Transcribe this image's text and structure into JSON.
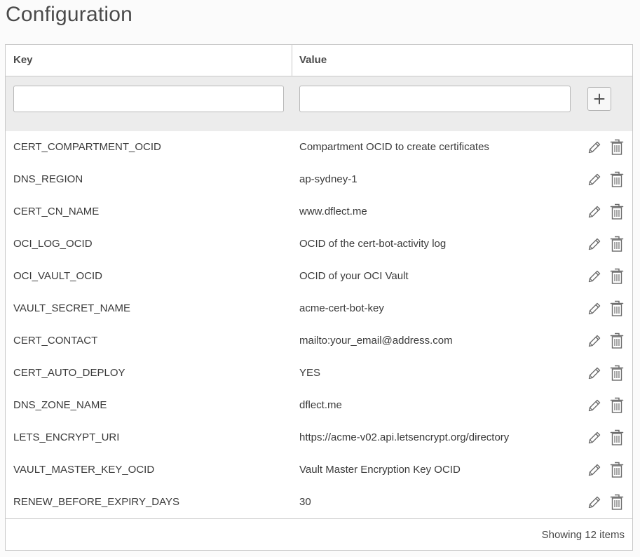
{
  "page": {
    "title": "Configuration"
  },
  "table": {
    "columns": {
      "key": "Key",
      "value": "Value"
    },
    "new_entry": {
      "key_value": "",
      "value_value": "",
      "add_icon": "plus-icon"
    },
    "rows": [
      {
        "key": "CERT_COMPARTMENT_OCID",
        "value": "Compartment OCID to create certificates"
      },
      {
        "key": "DNS_REGION",
        "value": "ap-sydney-1"
      },
      {
        "key": "CERT_CN_NAME",
        "value": "www.dflect.me"
      },
      {
        "key": "OCI_LOG_OCID",
        "value": "OCID of the cert-bot-activity log"
      },
      {
        "key": "OCI_VAULT_OCID",
        "value": "OCID of your OCI Vault"
      },
      {
        "key": "VAULT_SECRET_NAME",
        "value": "acme-cert-bot-key"
      },
      {
        "key": "CERT_CONTACT",
        "value": "mailto:your_email@address.com"
      },
      {
        "key": "CERT_AUTO_DEPLOY",
        "value": "YES"
      },
      {
        "key": "DNS_ZONE_NAME",
        "value": "dflect.me"
      },
      {
        "key": "LETS_ENCRYPT_URI",
        "value": "https://acme-v02.api.letsencrypt.org/directory"
      },
      {
        "key": "VAULT_MASTER_KEY_OCID",
        "value": "Vault Master Encryption Key OCID"
      },
      {
        "key": "RENEW_BEFORE_EXPIRY_DAYS",
        "value": "30"
      }
    ],
    "row_icons": {
      "edit": "pencil-icon",
      "delete": "trash-icon"
    },
    "footer": {
      "status": "Showing 12 items"
    }
  },
  "colors": {
    "background": "#fbfbfb",
    "table_border": "#c8c8c8",
    "input_band": "#ececec",
    "text": "#3a3a3a",
    "icon": "#6b6b6b"
  }
}
